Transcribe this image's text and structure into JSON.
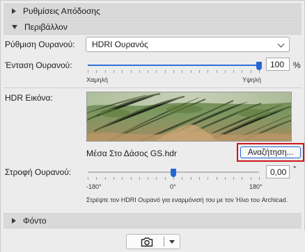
{
  "sections": {
    "render_settings": "Ρυθμίσεις Απόδοσης",
    "environment": "Περιβάλλον",
    "background": "Φόντο"
  },
  "sky_setting": {
    "label": "Ρύθμιση Ουρανού:",
    "value": "HDRI Ουρανός"
  },
  "sky_intensity": {
    "label": "Ένταση Ουρανού:",
    "value": "100",
    "unit": "%",
    "min_label": "Χαμηλή",
    "max_label": "Υψηλή",
    "level_percent": 100
  },
  "hdr_image": {
    "label": "HDR Εικόνα:",
    "filename": "Μέσα Στο Δάσος GS.hdr",
    "browse_label": "Αναζήτηση..."
  },
  "sky_rotation": {
    "label": "Στροφή Ουρανού:",
    "value": "0,00",
    "unit": "°",
    "min_label": "-180°",
    "mid_label": "0°",
    "max_label": "180°",
    "value_degrees": 0,
    "range": [
      -180,
      180
    ]
  },
  "hint_text": "Στρέψτε τον HDRI Ουρανό για εναρμόνισή του με τον Ήλιο του Archicad.",
  "footer": {
    "camera_icon": "camera-icon",
    "dropdown_icon": "dropdown-arrow-icon"
  },
  "colors": {
    "accent": "#2467d2",
    "highlight_border": "#d0131b"
  }
}
